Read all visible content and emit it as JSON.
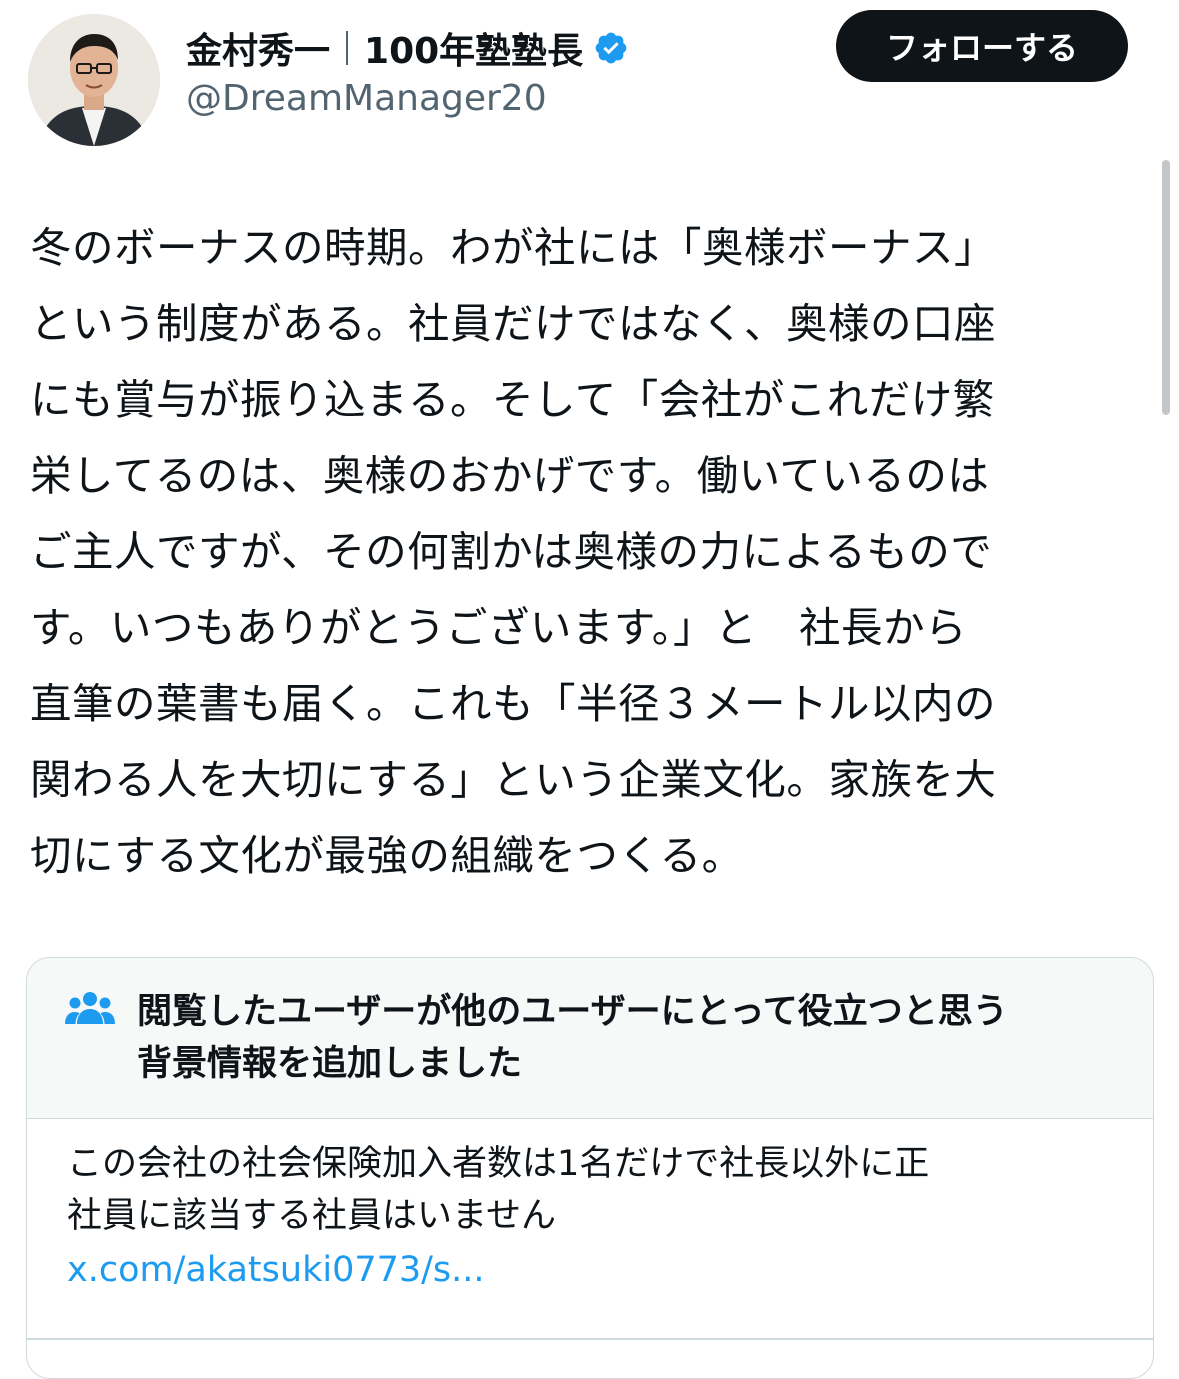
{
  "user": {
    "name": "金村秀一",
    "title": "100年塾塾長",
    "handle": "@DreamManager20",
    "verified": true,
    "avatar_icon": "person-photo-avatar"
  },
  "follow_button": {
    "label": "フォローする"
  },
  "tweet": {
    "lines": [
      "冬のボーナスの時期。わが社には「奥様ボーナス」",
      "という制度がある。社員だけではなく、奥様の口座",
      "にも賞与が振り込まる。そして「会社がこれだけ繁",
      "栄してるのは、奥様のおかげです。働いているのは",
      "ご主人ですが、その何割かは奥様の力によるもので",
      "す。いつもありがとうございます。」と　社長から",
      "直筆の葉書も届く。これも「半径３メートル以内の",
      "関わる人を大切にする」という企業文化。家族を大",
      "切にする文化が最強の組織をつくる。"
    ]
  },
  "community_note": {
    "icon": "people-group-icon",
    "title_lines": [
      "閲覧したユーザーが他のユーザーにとって役立つと思う",
      "背景情報を追加しました"
    ],
    "body_lines": [
      "この会社の社会保険加入者数は1名だけで社長以外に正",
      "社員に該当する社員はいません"
    ],
    "link": "x.com/akatsuki0773/s..."
  },
  "colors": {
    "text": "#0f1419",
    "secondary": "#536471",
    "link": "#1d9bf0",
    "verified": "#1d9bf0",
    "border": "#cfd9de",
    "note_header_bg": "#f7f9f9"
  }
}
